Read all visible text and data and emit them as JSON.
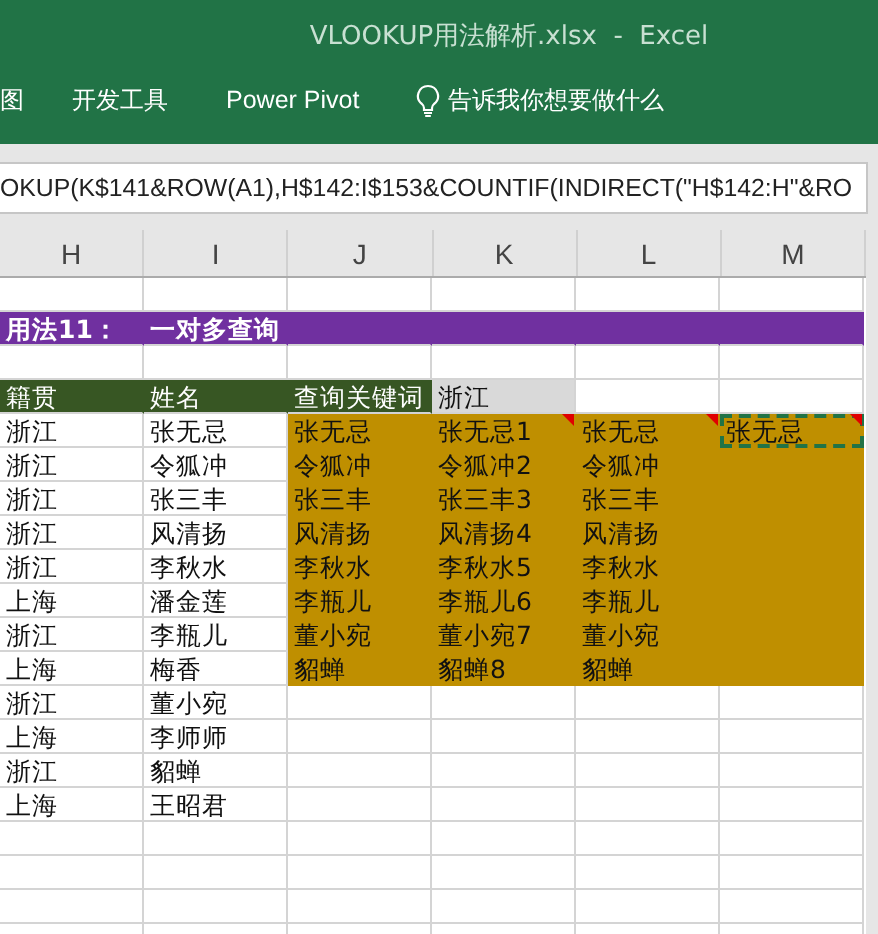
{
  "window": {
    "title": "VLOOKUP用法解析.xlsx  -  Excel"
  },
  "ribbon_tabs": [
    {
      "label": "图"
    },
    {
      "label": "开发工具"
    },
    {
      "label": "Power Pivot"
    }
  ],
  "tell_me": {
    "label": "告诉我你想要做什么"
  },
  "formula_bar": {
    "value": "OKUP(K$141&ROW(A1),H$142:I$153&COUNTIF(INDIRECT(\"H$142:H\"&RO"
  },
  "columns": [
    {
      "label": "H"
    },
    {
      "label": "I"
    },
    {
      "label": "J"
    },
    {
      "label": "K"
    },
    {
      "label": "L"
    },
    {
      "label": "M"
    }
  ],
  "rows": [
    {
      "kind": "blank"
    },
    {
      "kind": "cells",
      "cells": [
        {
          "text": "用法11：",
          "kind": "title",
          "comment": false,
          "selected": false
        },
        {
          "text": "一对多查询",
          "kind": "title",
          "comment": false,
          "selected": false
        },
        {
          "kind": "title",
          "comment": false,
          "selected": false
        },
        {
          "kind": "title",
          "comment": false,
          "selected": false
        },
        {
          "kind": "title",
          "comment": false,
          "selected": false
        },
        {
          "kind": "title",
          "comment": false,
          "selected": false
        }
      ]
    },
    {
      "kind": "blank"
    },
    {
      "kind": "cells",
      "cells": [
        {
          "text": "籍贯",
          "kind": "header",
          "comment": false,
          "selected": false
        },
        {
          "text": "姓名",
          "kind": "header",
          "comment": false,
          "selected": false
        },
        {
          "text": "查询关键词",
          "kind": "header",
          "comment": false,
          "selected": false
        },
        {
          "text": "浙江",
          "kind": "key",
          "comment": false,
          "selected": false
        }
      ]
    },
    {
      "kind": "cells",
      "cells": [
        {
          "text": "浙江",
          "kind": "plain",
          "comment": false,
          "selected": false
        },
        {
          "text": "张无忌",
          "kind": "plain",
          "comment": false,
          "selected": false
        },
        {
          "text": "张无忌",
          "kind": "result",
          "comment": false,
          "selected": false
        },
        {
          "text": "张无忌1",
          "kind": "result",
          "comment": true,
          "selected": false
        },
        {
          "text": "张无忌",
          "kind": "result",
          "comment": true,
          "selected": false
        },
        {
          "text": "张无忌",
          "kind": "result",
          "comment": true,
          "selected": true
        }
      ]
    },
    {
      "kind": "cells",
      "cells": [
        {
          "text": "浙江",
          "kind": "plain",
          "comment": false,
          "selected": false
        },
        {
          "text": "令狐冲",
          "kind": "plain",
          "comment": false,
          "selected": false
        },
        {
          "text": "令狐冲",
          "kind": "result",
          "comment": false,
          "selected": false
        },
        {
          "text": "令狐冲2",
          "kind": "result",
          "comment": false,
          "selected": false
        },
        {
          "text": "令狐冲",
          "kind": "result",
          "comment": false,
          "selected": false
        },
        {
          "kind": "result",
          "comment": false,
          "selected": false
        }
      ]
    },
    {
      "kind": "cells",
      "cells": [
        {
          "text": "浙江",
          "kind": "plain",
          "comment": false,
          "selected": false
        },
        {
          "text": "张三丰",
          "kind": "plain",
          "comment": false,
          "selected": false
        },
        {
          "text": "张三丰",
          "kind": "result",
          "comment": false,
          "selected": false
        },
        {
          "text": "张三丰3",
          "kind": "result",
          "comment": false,
          "selected": false
        },
        {
          "text": "张三丰",
          "kind": "result",
          "comment": false,
          "selected": false
        },
        {
          "kind": "result",
          "comment": false,
          "selected": false
        }
      ]
    },
    {
      "kind": "cells",
      "cells": [
        {
          "text": "浙江",
          "kind": "plain",
          "comment": false,
          "selected": false
        },
        {
          "text": "风清扬",
          "kind": "plain",
          "comment": false,
          "selected": false
        },
        {
          "text": "风清扬",
          "kind": "result",
          "comment": false,
          "selected": false
        },
        {
          "text": "风清扬4",
          "kind": "result",
          "comment": false,
          "selected": false
        },
        {
          "text": "风清扬",
          "kind": "result",
          "comment": false,
          "selected": false
        },
        {
          "kind": "result",
          "comment": false,
          "selected": false
        }
      ]
    },
    {
      "kind": "cells",
      "cells": [
        {
          "text": "浙江",
          "kind": "plain",
          "comment": false,
          "selected": false
        },
        {
          "text": "李秋水",
          "kind": "plain",
          "comment": false,
          "selected": false
        },
        {
          "text": "李秋水",
          "kind": "result",
          "comment": false,
          "selected": false
        },
        {
          "text": "李秋水5",
          "kind": "result",
          "comment": false,
          "selected": false
        },
        {
          "text": "李秋水",
          "kind": "result",
          "comment": false,
          "selected": false
        },
        {
          "kind": "result",
          "comment": false,
          "selected": false
        }
      ]
    },
    {
      "kind": "cells",
      "cells": [
        {
          "text": "上海",
          "kind": "plain",
          "comment": false,
          "selected": false
        },
        {
          "text": "潘金莲",
          "kind": "plain",
          "comment": false,
          "selected": false
        },
        {
          "text": "李瓶儿",
          "kind": "result",
          "comment": false,
          "selected": false
        },
        {
          "text": "李瓶儿6",
          "kind": "result",
          "comment": false,
          "selected": false
        },
        {
          "text": "李瓶儿",
          "kind": "result",
          "comment": false,
          "selected": false
        },
        {
          "kind": "result",
          "comment": false,
          "selected": false
        }
      ]
    },
    {
      "kind": "cells",
      "cells": [
        {
          "text": "浙江",
          "kind": "plain",
          "comment": false,
          "selected": false
        },
        {
          "text": "李瓶儿",
          "kind": "plain",
          "comment": false,
          "selected": false
        },
        {
          "text": "董小宛",
          "kind": "result",
          "comment": false,
          "selected": false
        },
        {
          "text": "董小宛7",
          "kind": "result",
          "comment": false,
          "selected": false
        },
        {
          "text": "董小宛",
          "kind": "result",
          "comment": false,
          "selected": false
        },
        {
          "kind": "result",
          "comment": false,
          "selected": false
        }
      ]
    },
    {
      "kind": "cells",
      "cells": [
        {
          "text": "上海",
          "kind": "plain",
          "comment": false,
          "selected": false
        },
        {
          "text": "梅香",
          "kind": "plain",
          "comment": false,
          "selected": false
        },
        {
          "text": "貂蝉",
          "kind": "result",
          "comment": false,
          "selected": false
        },
        {
          "text": "貂蝉8",
          "kind": "result",
          "comment": false,
          "selected": false
        },
        {
          "text": "貂蝉",
          "kind": "result",
          "comment": false,
          "selected": false
        },
        {
          "kind": "result",
          "comment": false,
          "selected": false
        }
      ]
    },
    {
      "kind": "cells",
      "cells": [
        {
          "text": "浙江",
          "kind": "plain",
          "comment": false,
          "selected": false
        },
        {
          "text": "董小宛",
          "kind": "plain",
          "comment": false,
          "selected": false
        }
      ]
    },
    {
      "kind": "cells",
      "cells": [
        {
          "text": "上海",
          "kind": "plain",
          "comment": false,
          "selected": false
        },
        {
          "text": "李师师",
          "kind": "plain",
          "comment": false,
          "selected": false
        }
      ]
    },
    {
      "kind": "cells",
      "cells": [
        {
          "text": "浙江",
          "kind": "plain",
          "comment": false,
          "selected": false
        },
        {
          "text": "貂蝉",
          "kind": "plain",
          "comment": false,
          "selected": false
        }
      ]
    },
    {
      "kind": "cells",
      "cells": [
        {
          "text": "上海",
          "kind": "plain",
          "comment": false,
          "selected": false
        },
        {
          "text": "王昭君",
          "kind": "plain",
          "comment": false,
          "selected": false
        }
      ]
    },
    {
      "kind": "blank"
    },
    {
      "kind": "blank"
    },
    {
      "kind": "blank"
    },
    {
      "kind": "blank"
    }
  ]
}
